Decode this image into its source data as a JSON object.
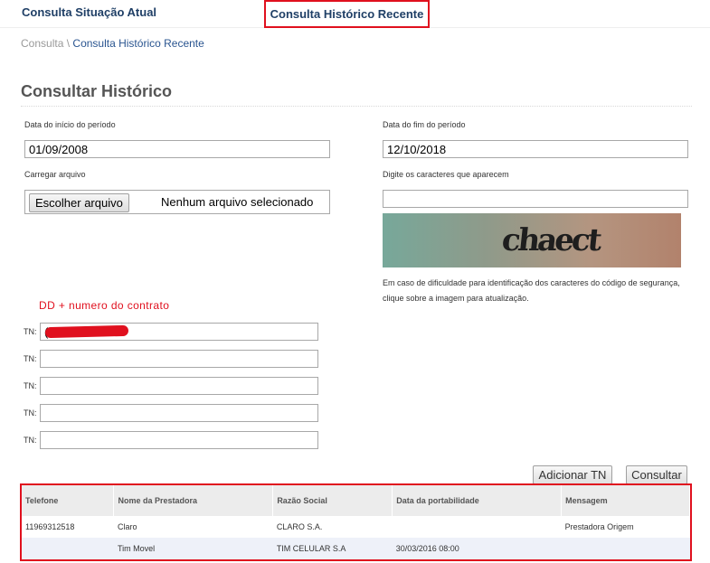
{
  "nav": {
    "tab_atual": "Consulta Situação Atual",
    "tab_historico": "Consulta Histórico Recente"
  },
  "breadcrumb": {
    "root": "Consulta",
    "separator": "\\",
    "current": "Consulta Histórico Recente"
  },
  "page_title": "Consultar Histórico",
  "form": {
    "start_label": "Data do início do período",
    "start_value": "01/09/2008",
    "end_label": "Data do fim do período",
    "end_value": "12/10/2018",
    "file_label": "Carregar arquivo",
    "file_button": "Escolher arquivo",
    "file_status": "Nenhum arquivo selecionado",
    "captcha_label": "Digite os caracteres que aparecem",
    "captcha_value": "",
    "captcha_image_text": "chaect",
    "captcha_help": "Em caso de dificuldade para identificação dos caracteres do código de segurança, clique sobre a imagem para atualização."
  },
  "annotation": "DD + numero do contrato",
  "tn": {
    "label": "TN:",
    "values": [
      "(",
      "",
      "",
      "",
      ""
    ]
  },
  "buttons": {
    "add": "Adicionar TN",
    "submit": "Consultar"
  },
  "table": {
    "headers": [
      "Telefone",
      "Nome da Prestadora",
      "Razão Social",
      "Data da portabilidade",
      "Mensagem"
    ],
    "rows": [
      [
        "11969312518",
        "Claro",
        "CLARO S.A.",
        "",
        "Prestadora Origem"
      ],
      [
        "",
        "Tim Movel",
        "TIM CELULAR S.A",
        "30/03/2016 08:00",
        ""
      ]
    ]
  },
  "colors": {
    "highlight": "#e0101e",
    "nav_text": "#1f3f66",
    "link": "#2a5590",
    "table_header_bg": "#ececec",
    "row_alt_bg": "#eef1f9"
  }
}
